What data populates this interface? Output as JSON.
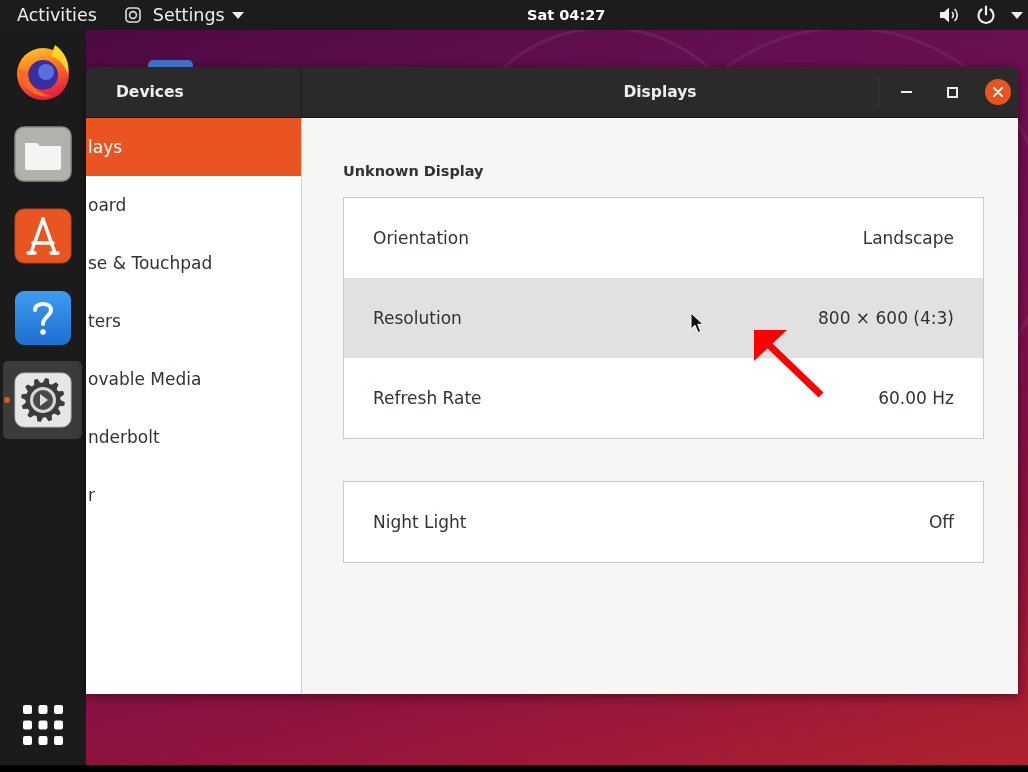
{
  "top_bar": {
    "activities": "Activities",
    "app_menu": "Settings",
    "clock": "Sat 04:27"
  },
  "dock": {
    "apps": [
      {
        "kind": "browser",
        "running": false
      },
      {
        "kind": "files",
        "running": false
      },
      {
        "kind": "software",
        "running": false
      },
      {
        "kind": "help",
        "running": false
      },
      {
        "kind": "settings",
        "running": true
      }
    ]
  },
  "window": {
    "sidebar_title": "Devices",
    "title": "Displays",
    "sidebar": {
      "items": [
        {
          "label": "lays",
          "selected": true
        },
        {
          "label": "oard",
          "selected": false
        },
        {
          "label": "se & Touchpad",
          "selected": false
        },
        {
          "label": "ters",
          "selected": false
        },
        {
          "label": "ovable Media",
          "selected": false
        },
        {
          "label": "nderbolt",
          "selected": false
        },
        {
          "label": "r",
          "selected": false
        }
      ]
    },
    "content": {
      "heading": "Unknown Display",
      "groups": [
        {
          "rows": [
            {
              "label": "Orientation",
              "value": "Landscape",
              "highlighted": false
            },
            {
              "label": "Resolution",
              "value": "800 × 600 (4:3)",
              "highlighted": true
            },
            {
              "label": "Refresh Rate",
              "value": "60.00 Hz",
              "highlighted": false
            }
          ]
        },
        {
          "rows": [
            {
              "label": "Night Light",
              "value": "Off",
              "highlighted": false
            }
          ]
        }
      ]
    }
  }
}
